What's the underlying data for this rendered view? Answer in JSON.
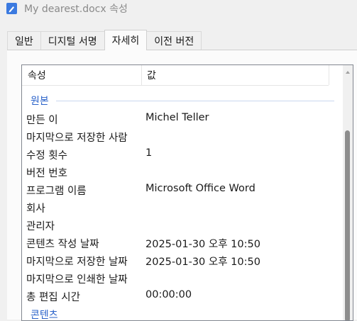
{
  "window": {
    "title": "My dearest.docx 속성"
  },
  "tabs": [
    {
      "label": "일반"
    },
    {
      "label": "디지털 서명"
    },
    {
      "label": "자세히"
    },
    {
      "label": "이전 버전"
    }
  ],
  "active_tab": "자세히",
  "columns": {
    "property": "속성",
    "value": "값"
  },
  "sections": {
    "origin": "원본",
    "content_partial": "콘텐츠"
  },
  "properties": [
    {
      "name": "만든 이",
      "value": "Michel Teller"
    },
    {
      "name": "마지막으로 저장한 사람",
      "value": ""
    },
    {
      "name": "수정 횟수",
      "value": "1"
    },
    {
      "name": "버전 번호",
      "value": ""
    },
    {
      "name": "프로그램 이름",
      "value": "Microsoft Office Word"
    },
    {
      "name": "회사",
      "value": ""
    },
    {
      "name": "관리자",
      "value": ""
    },
    {
      "name": "콘텐츠 작성 날짜",
      "value": "2025-01-30 오후 10:50"
    },
    {
      "name": "마지막으로 저장한 날짜",
      "value": "2025-01-30 오후 10:50"
    },
    {
      "name": "마지막으로 인쇄한 날짜",
      "value": ""
    },
    {
      "name": "총 편집 시간",
      "value": "00:00:00"
    }
  ],
  "colors": {
    "accent": "#2a62c9",
    "icon": "#3b7ae0"
  },
  "icons": {
    "window": "document-edit-icon"
  }
}
